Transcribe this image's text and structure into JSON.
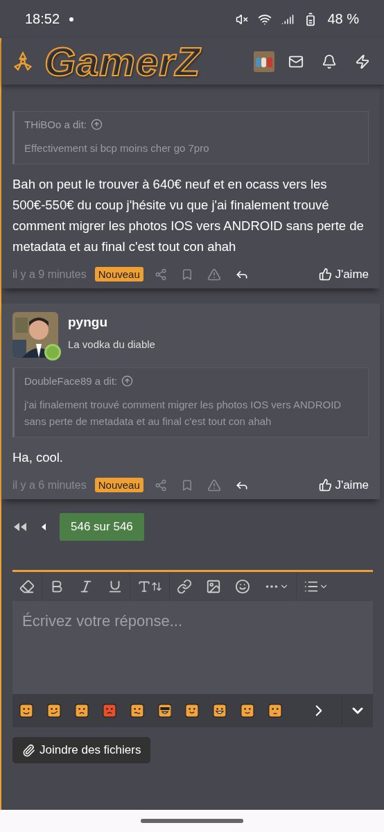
{
  "status_bar": {
    "time": "18:52",
    "battery": "48 %"
  },
  "header": {
    "logo": "GamerZ"
  },
  "posts": [
    {
      "quote": {
        "author": "THiBOo a dit:",
        "text": "Effectivement si bcp moins cher go 7pro"
      },
      "body": "Bah on peut le trouver à 640€ neuf et en ocass vers les 500€-550€ du coup j'hésite vu que j'ai finalement trouvé comment migrer les photos IOS vers ANDROID sans perte de metadata et au final c'est tout con ahah",
      "time": "il y a 9 minutes",
      "badge": "Nouveau",
      "like": "J'aime"
    },
    {
      "author": {
        "name": "pyngu",
        "title": "La vodka du diable",
        "online": true
      },
      "quote": {
        "author": "DoubleFace89 a dit:",
        "text": "j'ai finalement trouvé comment migrer les photos IOS vers ANDROID sans perte de metadata et au final c'est tout con ahah"
      },
      "body": "Ha, cool.",
      "time": "il y a 6 minutes",
      "badge": "Nouveau",
      "like": "J'aime"
    }
  ],
  "pagination": {
    "label": "546 sur 546"
  },
  "editor": {
    "placeholder": "Écrivez votre réponse...",
    "emojis": [
      {
        "kind": "smile",
        "color": "#f2a33a"
      },
      {
        "kind": "wink",
        "color": "#f2a33a"
      },
      {
        "kind": "sad",
        "color": "#f2a33a"
      },
      {
        "kind": "angry",
        "color": "#e8502a"
      },
      {
        "kind": "worried",
        "color": "#f2a33a"
      },
      {
        "kind": "cool",
        "color": "#f2a33a"
      },
      {
        "kind": "tongue",
        "color": "#f2a33a"
      },
      {
        "kind": "grin",
        "color": "#f2a33a"
      },
      {
        "kind": "squint",
        "color": "#f2a33a"
      },
      {
        "kind": "eyeroll",
        "color": "#f2a33a"
      }
    ]
  },
  "attach_button": "Joindre des fichiers"
}
